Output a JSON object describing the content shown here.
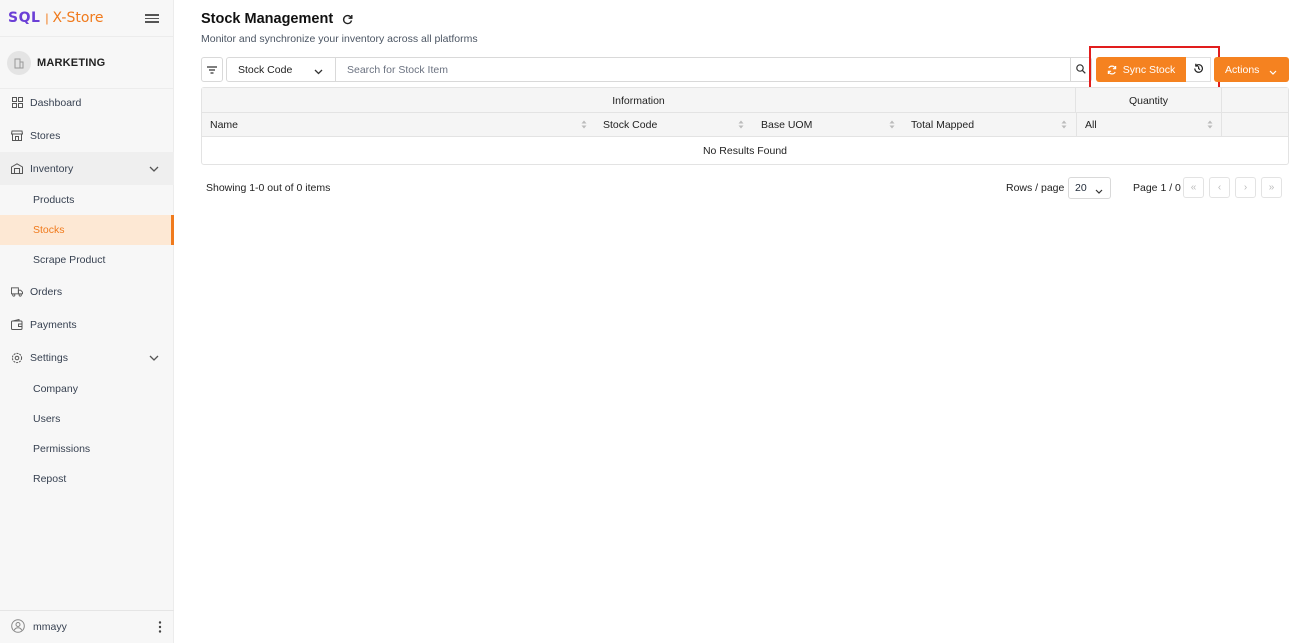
{
  "app": {
    "brand_left": "SQL",
    "brand_sep": "|",
    "brand_right": "X-Store"
  },
  "org": {
    "name": "MARKETING"
  },
  "sidebar": {
    "items": [
      {
        "label": "Dashboard",
        "icon": "grid-icon"
      },
      {
        "label": "Stores",
        "icon": "store-icon"
      },
      {
        "label": "Inventory",
        "icon": "warehouse-icon",
        "expanded": true,
        "children": [
          {
            "label": "Products"
          },
          {
            "label": "Stocks",
            "active": true
          },
          {
            "label": "Scrape Product"
          }
        ]
      },
      {
        "label": "Orders",
        "icon": "truck-icon"
      },
      {
        "label": "Payments",
        "icon": "wallet-icon"
      },
      {
        "label": "Settings",
        "icon": "gear-icon",
        "expanded": true,
        "children": [
          {
            "label": "Company"
          },
          {
            "label": "Users"
          },
          {
            "label": "Permissions"
          },
          {
            "label": "Repost"
          }
        ]
      }
    ]
  },
  "user": {
    "name": "mmayy"
  },
  "page": {
    "title": "Stock Management",
    "subtitle": "Monitor and synchronize your inventory across all platforms"
  },
  "toolbar": {
    "search_field": "Stock Code",
    "search_placeholder": "Search for Stock Item",
    "sync_label": "Sync Stock",
    "actions_label": "Actions"
  },
  "table": {
    "groups": [
      "Information",
      "Quantity"
    ],
    "columns": [
      "Name",
      "Stock Code",
      "Base UOM",
      "Total Mapped",
      "All"
    ],
    "empty_text": "No Results Found"
  },
  "pagination": {
    "showing": "Showing 1-0 out of 0 items",
    "rows_label": "Rows / page",
    "rows_per_page": "20",
    "page_label": "Page 1 / 0"
  },
  "colors": {
    "accent": "#f58220",
    "brand_purple": "#6b3fd6",
    "highlight": "#e11d1d"
  }
}
